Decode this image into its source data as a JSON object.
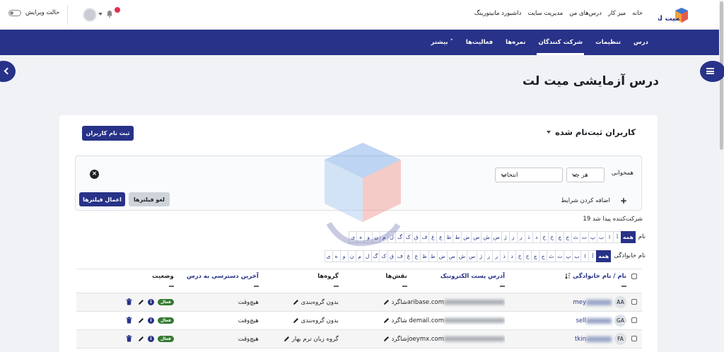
{
  "topbar": {
    "logo_text": "میت لت",
    "nav": [
      "خانه",
      "میز کار",
      "درس‌های من",
      "مدیریت سایت",
      "داشبورد مانیتورینگ"
    ],
    "edit_mode": "حالت ویرایش"
  },
  "course_nav": {
    "tabs": [
      "درس",
      "تنظیمات",
      "شرکت کنندگان",
      "نمره‌ها",
      "فعالیت‌ها",
      "بیشتر"
    ],
    "active": "شرکت کنندگان"
  },
  "page": {
    "title": "درس آزمایشی میت لت"
  },
  "participants": {
    "heading": "کاربران ثبت‌نام شده",
    "enroll_button": "ثبت نام کاربران",
    "filter": {
      "match_label": "همخوانی",
      "match_value": "هر چه",
      "select_placeholder": "انتخاب",
      "add_condition": "اضافه کردن شرایط",
      "clear_button": "لغو فیلترها",
      "apply_button": "اعمال فیلترها"
    },
    "count_text": "19 شرکت‌کننده پیدا شد",
    "firstname_label": "نام",
    "lastname_label": "نام خانوادگی",
    "firstname_letters": [
      "همه",
      "آ",
      "ا",
      "ب",
      "پ",
      "ت",
      "ث",
      "ج",
      "چ",
      "ح",
      "خ",
      "د",
      "ذ",
      "ر",
      "ز",
      "ژ",
      "س",
      "ش",
      "ص",
      "ض",
      "ط",
      "ظ",
      "ع",
      "غ",
      "ف",
      "ق",
      "ک",
      "گ",
      "ل",
      "م",
      "ن",
      "و",
      "ه",
      "ی"
    ],
    "lastname_letters": [
      "همه",
      "آ",
      "ا",
      "ب",
      "پ",
      "ت",
      "ث",
      "ج",
      "چ",
      "ح",
      "خ",
      "د",
      "ذ",
      "ر",
      "ز",
      "ژ",
      "س",
      "ش",
      "ص",
      "ض",
      "ط",
      "ظ",
      "ع",
      "غ",
      "ف",
      "ق",
      "ک",
      "گ",
      "ل",
      "م",
      "ن",
      "و",
      "ه",
      "ی"
    ],
    "columns": {
      "name": "نام / نام خانوادگی",
      "email": "آدرس پست الکترونیک",
      "roles": "نقش‌ها",
      "groups": "گروه‌ها",
      "last_access": "آخرین دسترسی به درس",
      "status": "وضعیت"
    },
    "rows": [
      {
        "initials": "AA",
        "name_tail": "mey",
        "email_tail": "aribase.com",
        "role": "شاگرد",
        "group": "بدون گروه‌بندی",
        "last_access": "هیچ‌وقت",
        "status": "فعال"
      },
      {
        "initials": "GA",
        "name_tail": "sell",
        "email_tail": "demail.com",
        "role": "شاگرد",
        "group": "بدون گروه‌بندی",
        "last_access": "هیچ‌وقت",
        "status": "فعال"
      },
      {
        "initials": "FA",
        "name_tail": "tkin",
        "email_tail": "joeymx.com",
        "role": "شاگرد",
        "group": "گروه زبان ترم بهار",
        "last_access": "هیچ‌وقت",
        "status": "فعال"
      }
    ]
  },
  "colors": {
    "primary": "#273288",
    "success": "#357a32",
    "notification": "#e12f50"
  }
}
